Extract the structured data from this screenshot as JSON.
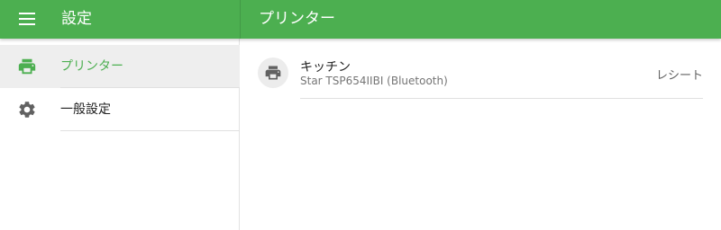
{
  "appbar": {
    "menu_icon": "menu-icon",
    "sidebar_title": "設定",
    "content_title": "プリンター",
    "color": "#4caf50"
  },
  "sidebar": {
    "items": [
      {
        "label": "プリンター",
        "icon": "printer-icon",
        "selected": true
      },
      {
        "label": "一般設定",
        "icon": "gear-icon",
        "selected": false
      }
    ]
  },
  "printers": [
    {
      "name": "キッチン",
      "model": "Star TSP654IIBI (Bluetooth)",
      "role": "レシート",
      "icon": "printer-icon"
    }
  ],
  "colors": {
    "accent": "#4caf50",
    "selected_bg": "#eeeeee",
    "icon": "#616161"
  }
}
